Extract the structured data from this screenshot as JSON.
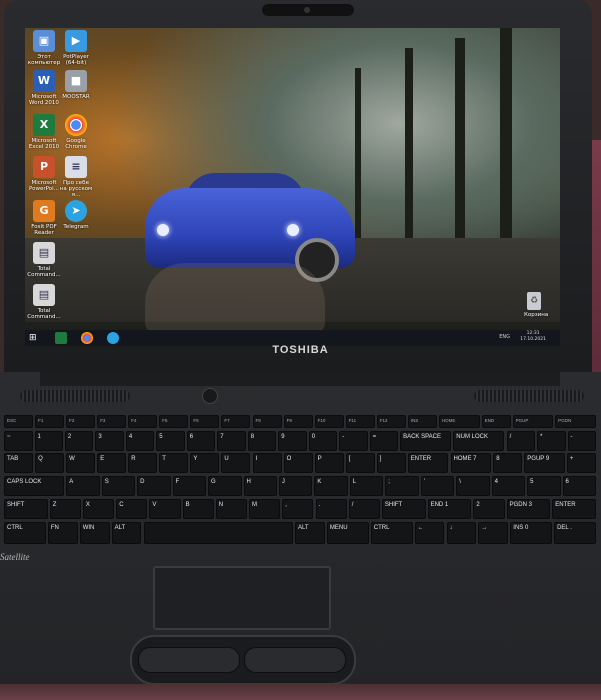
{
  "brand": "TOSHIBA",
  "series_badge": "Satellite",
  "desktop_icons": [
    {
      "label": "Этот компьютер",
      "icon": "computer-icon",
      "color": "#5a8fd8"
    },
    {
      "label": "PotPlayer (64-bit)",
      "icon": "potplayer-icon",
      "color": "#3a9ae0"
    },
    {
      "label": "Microsoft Word 2010",
      "icon": "word-icon",
      "color": "#2b5fb5"
    },
    {
      "label": "MOOSTAR",
      "icon": "app-icon",
      "color": "#9aa0a8"
    },
    {
      "label": "Microsoft Excel 2010",
      "icon": "excel-icon",
      "color": "#1f7a3e"
    },
    {
      "label": "Google Chrome",
      "icon": "chrome-icon",
      "color": "#e8e8e8"
    },
    {
      "label": "Microsoft PowerPoi...",
      "icon": "powerpoint-icon",
      "color": "#c8502a"
    },
    {
      "label": "Про себе на русском я...",
      "icon": "document-icon",
      "color": "#d8dde8"
    },
    {
      "label": "Foxit PDF Reader",
      "icon": "pdf-icon",
      "color": "#e07a20"
    },
    {
      "label": "Telegram",
      "icon": "telegram-icon",
      "color": "#2aa3e0"
    },
    {
      "label": "Total Command...",
      "icon": "totalcommander-icon",
      "color": "#d8d8d8"
    },
    {
      "label": "Total Command...",
      "icon": "totalcommander-icon",
      "color": "#d8d8d8"
    }
  ],
  "recycle_bin": {
    "label": "Корзина",
    "icon": "recycle-bin-icon"
  },
  "taskbar": {
    "tray": "ENG",
    "time": "12:31",
    "date": "17.10.2021"
  },
  "keyboard_rows": [
    [
      "ESC",
      "F1",
      "F2",
      "F3",
      "F4",
      "F5",
      "F6",
      "F7",
      "F8",
      "F9",
      "F10",
      "F11",
      "F12",
      "INS",
      "HOME",
      "END",
      "PGUP",
      "PGDN"
    ],
    [
      "~",
      "1",
      "2",
      "3",
      "4",
      "5",
      "6",
      "7",
      "8",
      "9",
      "0",
      "-",
      "=",
      "BACK SPACE",
      "NUM LOCK",
      "/",
      "*",
      "-"
    ],
    [
      "TAB",
      "Q",
      "W",
      "E",
      "R",
      "T",
      "Y",
      "U",
      "I",
      "O",
      "P",
      "[",
      "]",
      "ENTER",
      "HOME 7",
      "8",
      "PGUP 9",
      "+"
    ],
    [
      "CAPS LOCK",
      "A",
      "S",
      "D",
      "F",
      "G",
      "H",
      "J",
      "K",
      "L",
      ";",
      "'",
      "\\",
      "4",
      "5",
      "6"
    ],
    [
      "SHIFT",
      "Z",
      "X",
      "C",
      "V",
      "B",
      "N",
      "M",
      ",",
      ".",
      "/",
      "SHIFT",
      "END 1",
      "2",
      "PGDN 3",
      "ENTER"
    ],
    [
      "CTRL",
      "FN",
      "WIN",
      "ALT",
      "",
      "ALT",
      "MENU",
      "CTRL",
      "←",
      "↓",
      "→",
      "INS 0",
      "DEL ."
    ]
  ]
}
